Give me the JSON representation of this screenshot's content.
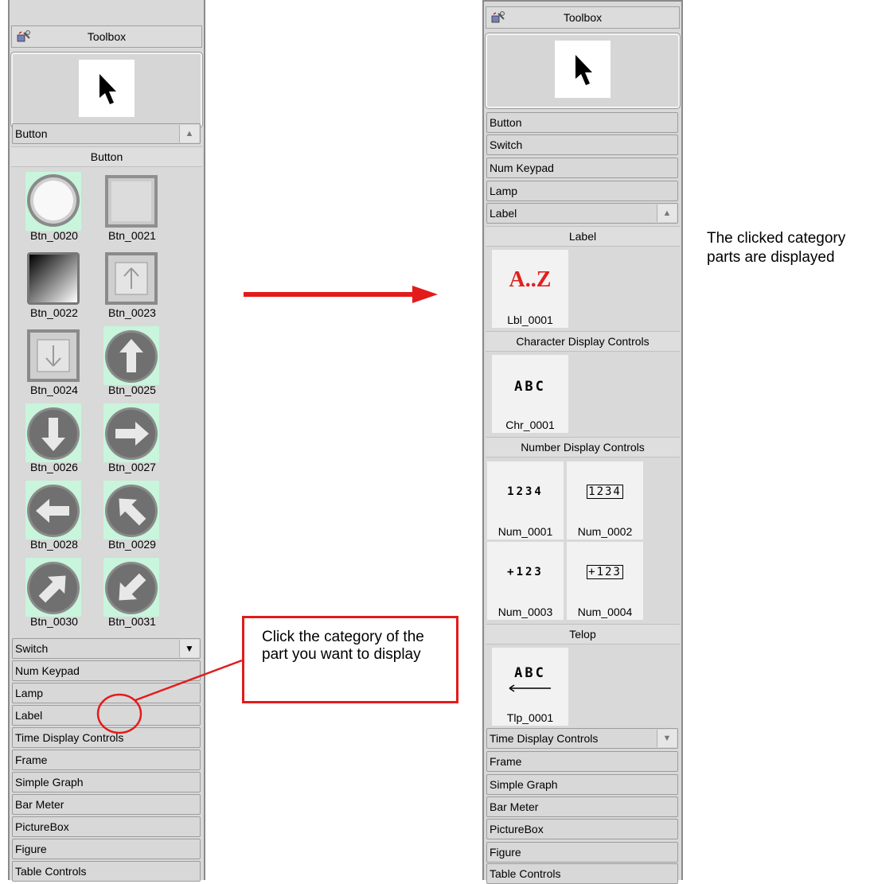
{
  "left": {
    "title": "Toolbox",
    "open_category": "Button",
    "group": "Button",
    "items": [
      "Btn_0020",
      "Btn_0021",
      "Btn_0022",
      "Btn_0023",
      "Btn_0024",
      "Btn_0025",
      "Btn_0026",
      "Btn_0027",
      "Btn_0028",
      "Btn_0029",
      "Btn_0030",
      "Btn_0031"
    ],
    "categories": [
      "Switch",
      "Num Keypad",
      "Lamp",
      "Label",
      "Time Display Controls",
      "Frame",
      "Simple Graph",
      "Bar Meter",
      "PictureBox",
      "Figure",
      "Table Controls"
    ]
  },
  "right": {
    "title": "Toolbox",
    "top_categories": [
      "Button",
      "Switch",
      "Num Keypad",
      "Lamp",
      "Label"
    ],
    "groups": {
      "label": {
        "title": "Label",
        "items": [
          {
            "name": "Lbl_0001",
            "glyph": "A..Z"
          }
        ]
      },
      "chr": {
        "title": "Character Display Controls",
        "items": [
          {
            "name": "Chr_0001",
            "glyph": "ABC"
          }
        ]
      },
      "num": {
        "title": "Number Display Controls",
        "items": [
          {
            "name": "Num_0001",
            "glyph": "1234"
          },
          {
            "name": "Num_0002",
            "glyph": "1234"
          },
          {
            "name": "Num_0003",
            "glyph": "+123"
          },
          {
            "name": "Num_0004",
            "glyph": "+123"
          }
        ]
      },
      "telop": {
        "title": "Telop",
        "items": [
          {
            "name": "Tlp_0001",
            "glyph": "ABC"
          }
        ]
      }
    },
    "bottom_categories": [
      "Time Display Controls",
      "Frame",
      "Simple Graph",
      "Bar Meter",
      "PictureBox",
      "Figure",
      "Table Controls"
    ]
  },
  "annotations": {
    "callout": "Click the category of the part you want to display",
    "note": "The clicked category parts are displayed"
  },
  "colors": {
    "accent": "#e31b1b",
    "highlight": "#c8f5dc"
  },
  "icons": {
    "toolbox": "toolbox-icon",
    "pointer": "pointer-arrow-icon"
  }
}
